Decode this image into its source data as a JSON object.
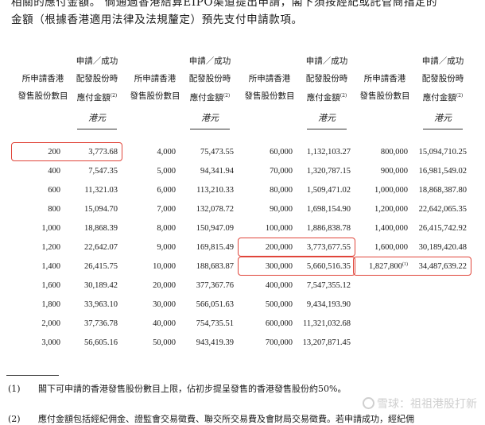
{
  "intro": {
    "line1": "相關的應付金額。 倘通過香港結算EIPO渠道提出申請，閣下須按經紀或託管商指定的",
    "line2": "金額（根據香港適用法律及法規釐定）預先支付申請款項。"
  },
  "headers": {
    "shares_l1": "所申請香港",
    "shares_l2": "發售股份數目",
    "amount_l1": "申請／成功",
    "amount_l2": "配發股份時",
    "amount_l3": "應付金額",
    "amount_note": "(2)",
    "unit": "港元"
  },
  "columns": [
    {
      "rows": [
        {
          "shares": "200",
          "amount": "3,773.68"
        },
        {
          "shares": "400",
          "amount": "7,547.35"
        },
        {
          "shares": "600",
          "amount": "11,321.03"
        },
        {
          "shares": "800",
          "amount": "15,094.70"
        },
        {
          "shares": "1,000",
          "amount": "18,868.39"
        },
        {
          "shares": "1,200",
          "amount": "22,642.07"
        },
        {
          "shares": "1,400",
          "amount": "26,415.75"
        },
        {
          "shares": "1,600",
          "amount": "30,189.42"
        },
        {
          "shares": "1,800",
          "amount": "33,963.10"
        },
        {
          "shares": "2,000",
          "amount": "37,736.78"
        },
        {
          "shares": "3,000",
          "amount": "56,605.16"
        }
      ]
    },
    {
      "rows": [
        {
          "shares": "4,000",
          "amount": "75,473.55"
        },
        {
          "shares": "5,000",
          "amount": "94,341.94"
        },
        {
          "shares": "6,000",
          "amount": "113,210.33"
        },
        {
          "shares": "7,000",
          "amount": "132,078.72"
        },
        {
          "shares": "8,000",
          "amount": "150,947.09"
        },
        {
          "shares": "9,000",
          "amount": "169,815.49"
        },
        {
          "shares": "10,000",
          "amount": "188,683.87"
        },
        {
          "shares": "20,000",
          "amount": "377,367.76"
        },
        {
          "shares": "30,000",
          "amount": "566,051.63"
        },
        {
          "shares": "40,000",
          "amount": "754,735.51"
        },
        {
          "shares": "50,000",
          "amount": "943,419.39"
        }
      ]
    },
    {
      "rows": [
        {
          "shares": "60,000",
          "amount": "1,132,103.27"
        },
        {
          "shares": "70,000",
          "amount": "1,320,787.15"
        },
        {
          "shares": "80,000",
          "amount": "1,509,471.02"
        },
        {
          "shares": "90,000",
          "amount": "1,698,154.90"
        },
        {
          "shares": "100,000",
          "amount": "1,886,838.78"
        },
        {
          "shares": "200,000",
          "amount": "3,773,677.55"
        },
        {
          "shares": "300,000",
          "amount": "5,660,516.35"
        },
        {
          "shares": "400,000",
          "amount": "7,547,355.12"
        },
        {
          "shares": "500,000",
          "amount": "9,434,193.90"
        },
        {
          "shares": "600,000",
          "amount": "11,321,032.68"
        },
        {
          "shares": "700,000",
          "amount": "13,207,871.45"
        }
      ]
    },
    {
      "rows": [
        {
          "shares": "800,000",
          "amount": "15,094,710.25"
        },
        {
          "shares": "900,000",
          "amount": "16,981,549.02"
        },
        {
          "shares": "1,000,000",
          "amount": "18,868,387.80"
        },
        {
          "shares": "1,200,000",
          "amount": "22,642,065.35"
        },
        {
          "shares": "1,400,000",
          "amount": "26,415,742.92"
        },
        {
          "shares": "1,600,000",
          "amount": "30,189,420.48"
        },
        {
          "shares": "1,827,800",
          "shares_note": "(1)",
          "amount": "34,487,639.22"
        }
      ]
    }
  ],
  "highlights": [
    {
      "column": 0,
      "row": 0
    },
    {
      "column": 2,
      "row": 5
    },
    {
      "column": 2,
      "row": 6
    },
    {
      "column": 3,
      "row": 6
    }
  ],
  "highlight_color": "#e0453a",
  "footnotes": [
    {
      "num": "(1)",
      "text": "閣下可申請的香港發售股份數目上限，佔初步提呈發售的香港發售股份約50%。"
    },
    {
      "num": "(2)",
      "text": "應付金額包括經紀佣金、證監會交易徵費、聯交所交易費及會財局交易徵費。若申請成功，經紀佣"
    }
  ],
  "watermark": "雪球：祖祖港股打新"
}
